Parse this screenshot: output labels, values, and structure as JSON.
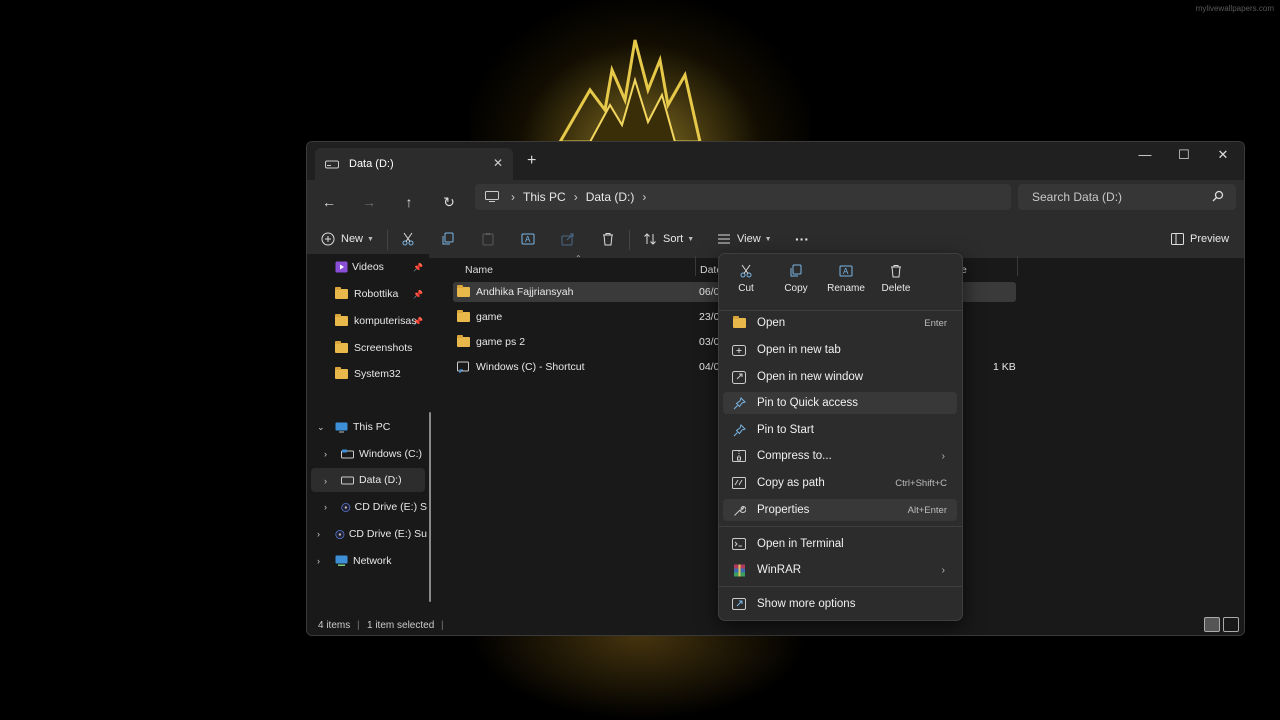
{
  "wallpaper": {
    "watermark": "mylivewallpapers.com"
  },
  "window": {
    "tab_title": "Data (D:)",
    "new_tab_label": "+",
    "controls": {
      "minimize": "—",
      "maximize": "☐",
      "close": "✕"
    }
  },
  "navbar": {
    "breadcrumbs": [
      "This PC",
      "Data (D:)"
    ],
    "search_placeholder": "Search Data (D:)"
  },
  "toolbar": {
    "new_label": "New",
    "sort_label": "Sort",
    "view_label": "View",
    "more_label": "···",
    "preview_label": "Preview"
  },
  "sidebar": {
    "quick_access": [
      {
        "label": "Videos",
        "icon": "videos-icon",
        "pinned": true
      },
      {
        "label": "Robottika",
        "icon": "folder-icon",
        "pinned": true
      },
      {
        "label": "komputerisasi",
        "icon": "folder-icon",
        "pinned": true
      },
      {
        "label": "Screenshots",
        "icon": "folder-icon",
        "pinned": false
      },
      {
        "label": "System32",
        "icon": "folder-icon",
        "pinned": false
      }
    ],
    "this_pc": {
      "label": "This PC",
      "children": [
        {
          "label": "Windows (C:)",
          "icon": "drive-icon"
        },
        {
          "label": "Data (D:)",
          "icon": "drive-icon",
          "selected": true
        },
        {
          "label": "CD Drive (E:) S",
          "icon": "cd-drive-icon"
        }
      ]
    },
    "cd_drive": {
      "label": "CD Drive (E:) Su",
      "icon": "cd-drive-icon"
    },
    "network": {
      "label": "Network",
      "icon": "network-icon"
    }
  },
  "columns": {
    "name": "Name",
    "date": "Date",
    "size_fragment": "e"
  },
  "files": [
    {
      "name": "Andhika Fajjriansyah",
      "date": "06/0",
      "size": "",
      "type": "folder",
      "selected": true
    },
    {
      "name": "game",
      "date": "23/0",
      "size": "",
      "type": "folder",
      "selected": false
    },
    {
      "name": "game ps 2",
      "date": "03/0",
      "size": "",
      "type": "folder",
      "selected": false
    },
    {
      "name": "Windows (C) - Shortcut",
      "date": "04/0",
      "size": "1 KB",
      "type": "shortcut",
      "selected": false
    }
  ],
  "statusbar": {
    "item_count": "4 items",
    "selection": "1 item selected"
  },
  "context_menu": {
    "quick_actions": [
      {
        "label": "Cut",
        "icon": "scissors-icon"
      },
      {
        "label": "Copy",
        "icon": "copy-icon"
      },
      {
        "label": "Rename",
        "icon": "rename-icon"
      },
      {
        "label": "Delete",
        "icon": "trash-icon"
      }
    ],
    "items": [
      {
        "label": "Open",
        "shortcut": "Enter",
        "icon": "folder-open-icon"
      },
      {
        "label": "Open in new tab",
        "shortcut": "",
        "icon": "new-tab-icon"
      },
      {
        "label": "Open in new window",
        "shortcut": "",
        "icon": "new-window-icon"
      },
      {
        "label": "Pin to Quick access",
        "shortcut": "",
        "icon": "pin-icon",
        "highlighted": true
      },
      {
        "label": "Pin to Start",
        "shortcut": "",
        "icon": "pin-icon"
      },
      {
        "label": "Compress to...",
        "shortcut": "",
        "icon": "zip-icon",
        "submenu": true
      },
      {
        "label": "Copy as path",
        "shortcut": "Ctrl+Shift+C",
        "icon": "copy-path-icon"
      },
      {
        "label": "Properties",
        "shortcut": "Alt+Enter",
        "icon": "wrench-icon",
        "highlighted": true
      },
      {
        "label": "Open in Terminal",
        "shortcut": "",
        "icon": "terminal-icon"
      },
      {
        "label": "WinRAR",
        "shortcut": "",
        "icon": "winrar-icon",
        "submenu": true
      },
      {
        "label": "Show more options",
        "shortcut": "",
        "icon": "more-options-icon"
      }
    ]
  },
  "colors": {
    "folder": "#e8b84b",
    "accent": "#4aa3df",
    "menu_bg": "#2c2c2c",
    "window_bg": "#191919"
  }
}
